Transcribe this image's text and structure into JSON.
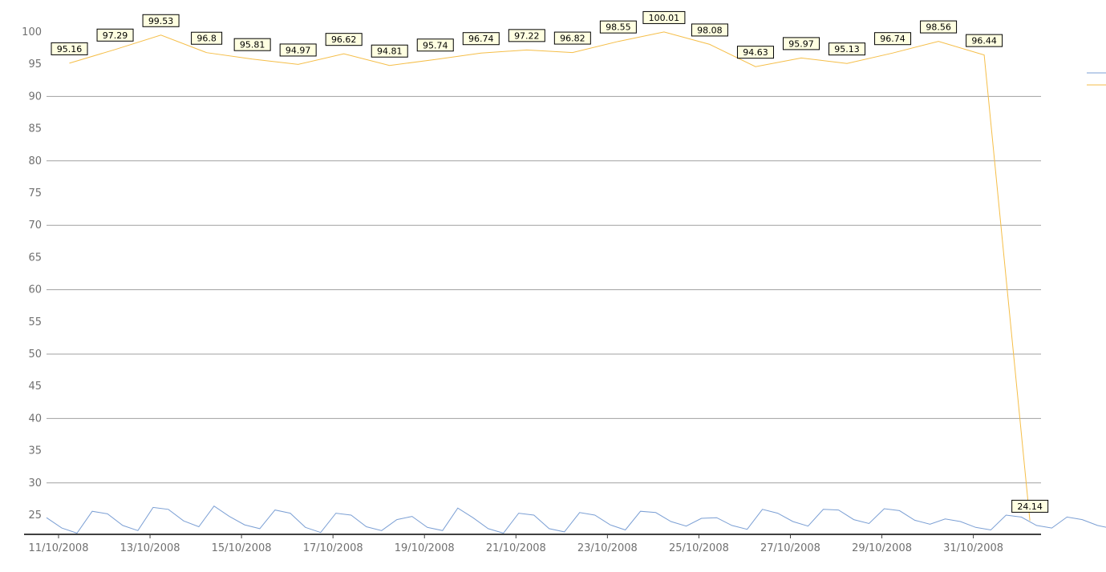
{
  "chart_data": {
    "type": "line",
    "ylim": [
      22,
      101
    ],
    "y_ticks": [
      25,
      30,
      35,
      40,
      45,
      50,
      55,
      60,
      65,
      70,
      75,
      80,
      85,
      90,
      95,
      100
    ],
    "grid": true,
    "legend_placement": "right",
    "x_tick_labels": [
      "11/10/2008",
      "13/10/2008",
      "15/10/2008",
      "17/10/2008",
      "19/10/2008",
      "21/10/2008",
      "23/10/2008",
      "25/10/2008",
      "27/10/2008",
      "29/10/2008",
      "31/10/2008"
    ],
    "series": [
      {
        "color": "#7b9fd4",
        "x_start": "11/10/2008",
        "step_days": 0.333,
        "values": [
          24.6,
          23.0,
          22.2,
          25.6,
          25.2,
          23.4,
          22.6,
          26.2,
          25.9,
          24.1,
          23.2,
          26.4,
          24.8,
          23.5,
          22.9,
          25.8,
          25.3,
          23.1,
          22.3,
          25.3,
          25.0,
          23.2,
          22.6,
          24.3,
          24.8,
          23.1,
          22.6,
          26.1,
          24.6,
          22.9,
          22.2,
          25.3,
          25.0,
          22.9,
          22.4,
          25.4,
          25.0,
          23.5,
          22.7,
          25.6,
          25.4,
          24.0,
          23.3,
          24.5,
          24.6,
          23.4,
          22.8,
          25.9,
          25.3,
          24.0,
          23.3,
          25.9,
          25.8,
          24.3,
          23.7,
          26.0,
          25.7,
          24.2,
          23.6,
          24.4,
          24.0,
          23.1,
          22.7,
          25.0,
          24.7,
          23.4,
          23.0,
          24.7,
          24.3,
          23.4,
          22.9,
          24.2,
          24.4,
          23.3,
          22.8,
          26.1,
          25.8,
          24.2,
          23.3,
          25.2,
          25.2,
          23.7,
          23.1,
          24.3,
          24.1
        ]
      },
      {
        "color": "#f5be48",
        "x_start": "11/10/2008",
        "x_offset_days": 0.5,
        "step_days": 1,
        "values": [
          95.16,
          97.29,
          99.53,
          96.8,
          95.81,
          94.97,
          96.62,
          94.81,
          95.74,
          96.74,
          97.22,
          96.82,
          98.55,
          100.01,
          98.08,
          94.63,
          95.97,
          95.13,
          96.74,
          98.56,
          96.44,
          24.14
        ],
        "labels": [
          "95.16",
          "97.29",
          "99.53",
          "96.8",
          "95.81",
          "94.97",
          "96.62",
          "94.81",
          "95.74",
          "96.74",
          "97.22",
          "96.82",
          "98.55",
          "100.01",
          "98.08",
          "94.63",
          "95.97",
          "95.13",
          "96.74",
          "98.56",
          "96.44",
          "24.14"
        ]
      }
    ]
  }
}
